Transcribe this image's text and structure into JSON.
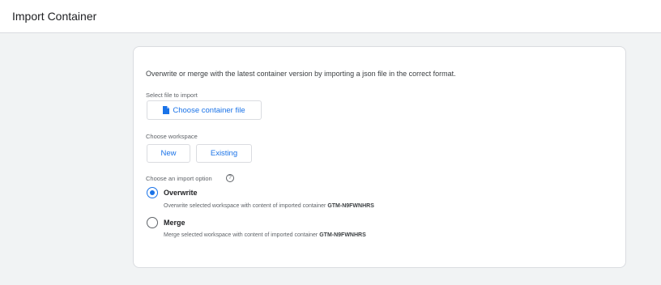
{
  "header": {
    "title": "Import Container"
  },
  "form": {
    "description": "Overwrite or merge with the latest container version by importing a json file in the correct format.",
    "file_label": "Select file to import",
    "file_button": "Choose container file",
    "workspace_label": "Choose workspace",
    "workspace_buttons": {
      "new": "New",
      "existing": "Existing"
    },
    "import_option_label": "Choose an import option",
    "options": [
      {
        "title": "Overwrite",
        "desc": "Overwrite selected workspace with content of imported container",
        "container_id": "GTM-N9FWNHRS",
        "selected": true
      },
      {
        "title": "Merge",
        "desc": "Merge selected workspace with content of imported container",
        "container_id": "GTM-N9FWNHRS",
        "selected": false
      }
    ]
  },
  "colors": {
    "accent": "#1a73e8",
    "background": "#f1f3f4",
    "border": "#dadce0"
  },
  "icons": {
    "file": "file-icon",
    "help": "help-circle-icon"
  }
}
